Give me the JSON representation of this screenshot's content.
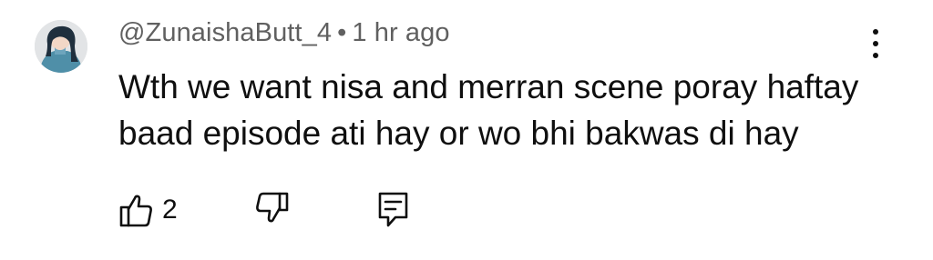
{
  "comment": {
    "author": "@ZunaishaButt_4",
    "separator": "•",
    "time": "1 hr ago",
    "text": "Wth we want nisa and merran scene poray haftay baad episode ati hay or wo bhi bakwas di hay",
    "like_count": "2"
  },
  "icons": {
    "avatar": "avatar-illustration",
    "menu": "more-vert-icon",
    "like": "thumbs-up-icon",
    "dislike": "thumbs-down-icon",
    "reply": "reply-comment-icon"
  }
}
